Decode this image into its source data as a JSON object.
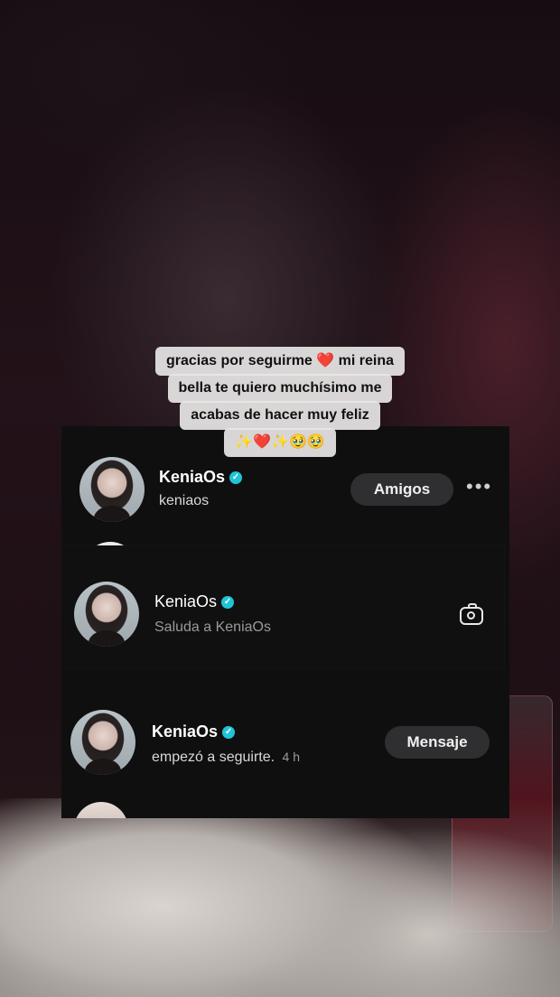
{
  "caption": {
    "line1_a": "gracias  por seguirme ",
    "line1_b": " mi reina",
    "line2": "bella te quiero muchísimo me",
    "line3": "acabas de hacer muy feliz",
    "line4": "✨❤️✨🥹🥹",
    "heart": "❤️"
  },
  "friend_row": {
    "name": "KeniaOs",
    "username": "keniaos",
    "button_label": "Amigos",
    "more_label": "•••"
  },
  "chat_row": {
    "name": "KeniaOs",
    "subtitle": "Saluda a KeniaOs"
  },
  "follow_row": {
    "name": "KeniaOs",
    "activity": "empezó a seguirte.",
    "time": "4 h",
    "button_label": "Mensaje"
  },
  "verified_mark": "✓",
  "colors": {
    "verified": "#20c4d8",
    "heart": "#ff2d63",
    "sheet_bg": "#0f0f10",
    "pill_bg": "#2f2f31"
  }
}
